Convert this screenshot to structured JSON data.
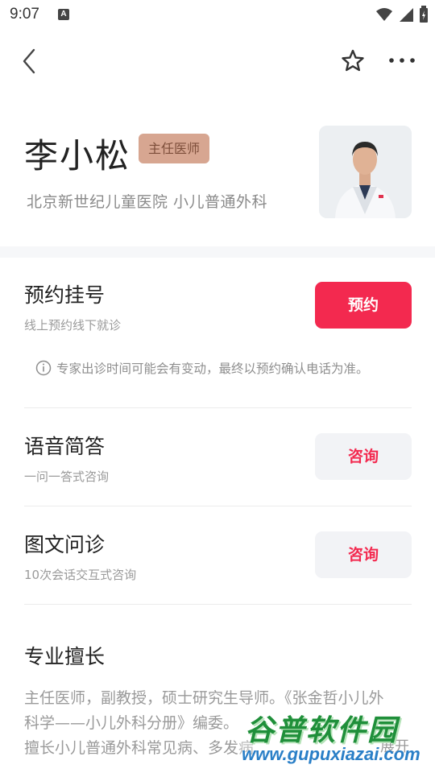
{
  "status_bar": {
    "time": "9:07",
    "notification_icon": "A"
  },
  "nav": {
    "back_icon": "chevron-left",
    "favorite_icon": "star-outline",
    "more_icon": "more-horizontal"
  },
  "doctor": {
    "name": "李小松",
    "title_badge": "主任医师",
    "hospital": "北京新世纪儿童医院  小儿普通外科"
  },
  "services": [
    {
      "title": "预约挂号",
      "subtitle": "线上预约线下就诊",
      "button": "预约"
    },
    {
      "title": "语音简答",
      "subtitle": "一问一答式咨询",
      "button": "咨询"
    },
    {
      "title": "图文问诊",
      "subtitle": "10次会话交互式咨询",
      "button": "咨询"
    }
  ],
  "notice": "专家出诊时间可能会有变动，最终以预约确认电话为准。",
  "specialty": {
    "title": "专业擅长",
    "line1": "主任医师，副教授，硕士研究生导师。《张金哲小儿外",
    "line2": "科学——小儿外科分册》编委。",
    "line3": "擅长小儿普通外科常见病、多发病",
    "expand": "展开"
  },
  "watermark": {
    "text": "谷普软件园",
    "url": "www.gupuxiazai.com"
  },
  "colors": {
    "accent": "#f3294f",
    "badge_bg": "#d7a691",
    "secondary_bg": "#f2f3f6"
  }
}
